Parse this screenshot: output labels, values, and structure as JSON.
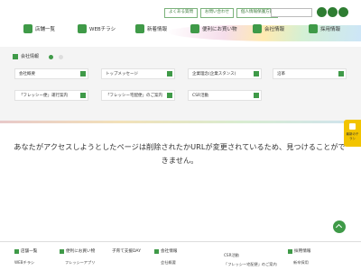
{
  "header": {
    "top_links": [
      "よくある質問",
      "お問い合わせ",
      "個人情報保護方針"
    ],
    "social_icons": [
      "instagram-icon",
      "twitter-icon",
      "facebook-icon"
    ],
    "nav": [
      {
        "label": "店舗一覧",
        "icon": "store-icon"
      },
      {
        "label": "WEBチラシ",
        "icon": "flyer-icon"
      },
      {
        "label": "新着情報",
        "icon": "news-icon"
      },
      {
        "label": "便利にお買い物",
        "icon": "cart-icon"
      },
      {
        "label": "会社情報",
        "icon": "company-icon"
      },
      {
        "label": "採用情報",
        "icon": "recruit-icon"
      }
    ]
  },
  "submenu": {
    "title": "会社情報",
    "items": [
      "会社概要",
      "トップメッセージ",
      "企業理念(企業スタンス)",
      "沿革",
      "「フレッシー便」運行案内",
      "「フレッシー宅配便」のご案内",
      "CSR活動"
    ]
  },
  "error_message": "あなたがアクセスしようとしたページは削除されたかURLが変更されているため、見つけることができません。",
  "side_tab": {
    "label": "最新のチラシ"
  },
  "footer": {
    "col1": {
      "head": "店舗一覧",
      "sub": "WEBチラシ"
    },
    "col2": {
      "head": "便利にお買い物",
      "sub": "フレッシーアプリ"
    },
    "col3": {
      "head": "子育て支援DAY"
    },
    "col4": {
      "head": "会社情報",
      "sub": "会社概要"
    },
    "col5": {
      "head": "CSR活動",
      "sub": "「フレッシー宅配便」のご案内"
    },
    "col6": {
      "head": "採用情報",
      "sub": "新卒採用"
    }
  },
  "colors": {
    "accent": "#3f9a48",
    "tab": "#f2c400"
  }
}
